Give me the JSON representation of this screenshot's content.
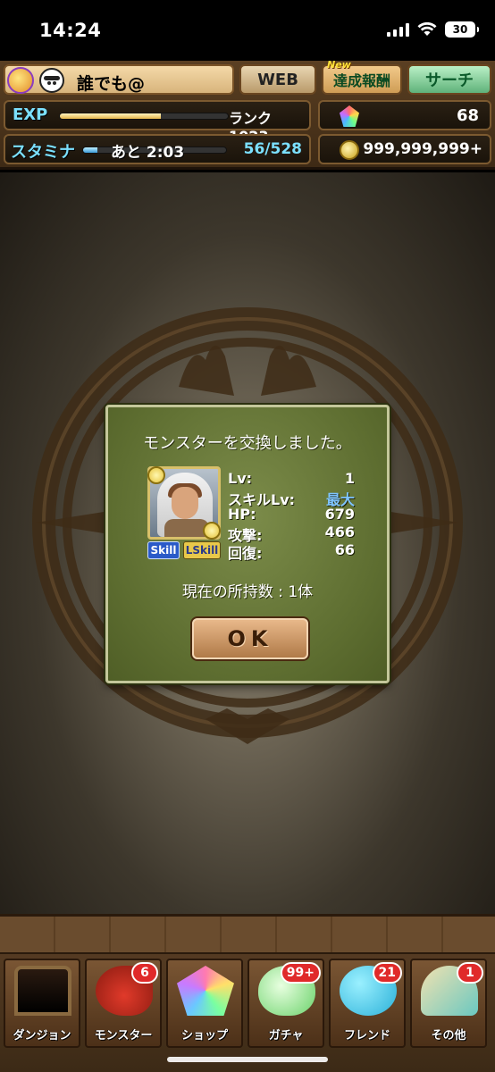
{
  "status_bar": {
    "time": "14:24",
    "battery": "30"
  },
  "header": {
    "player_name": "誰でも@",
    "web_button": "WEB",
    "achievement_new": "New",
    "achievement_button": "達成報酬",
    "search_button": "サーチ",
    "exp_label": "EXP",
    "exp_progress": 0.6,
    "rank": "ランク1023",
    "stamina_label": "スタミナ",
    "stamina_timer": "あと 2:03",
    "stamina_progress": 0.1,
    "stamina": "56/528",
    "magic_stones": "68",
    "coins": "999,999,999+"
  },
  "dialog": {
    "title": "モンスターを交換しました。",
    "skill_tag": "Skill",
    "leader_skill_tag": "LSkill",
    "stats": [
      {
        "label": "Lv:",
        "value": "1"
      },
      {
        "label": "スキルLv:",
        "value": "最大"
      },
      {
        "label": "HP:",
        "value": "679"
      },
      {
        "label": "攻撃:",
        "value": "466"
      },
      {
        "label": "回復:",
        "value": "66"
      }
    ],
    "holding": "現在の所持数 : 1体",
    "ok_button": "OK"
  },
  "bottom_nav": [
    {
      "label": "ダンジョン",
      "badge": ""
    },
    {
      "label": "モンスター",
      "badge": "6"
    },
    {
      "label": "ショップ",
      "badge": ""
    },
    {
      "label": "ガチャ",
      "badge": "99+"
    },
    {
      "label": "フレンド",
      "badge": "21"
    },
    {
      "label": "その他",
      "badge": "1"
    }
  ]
}
